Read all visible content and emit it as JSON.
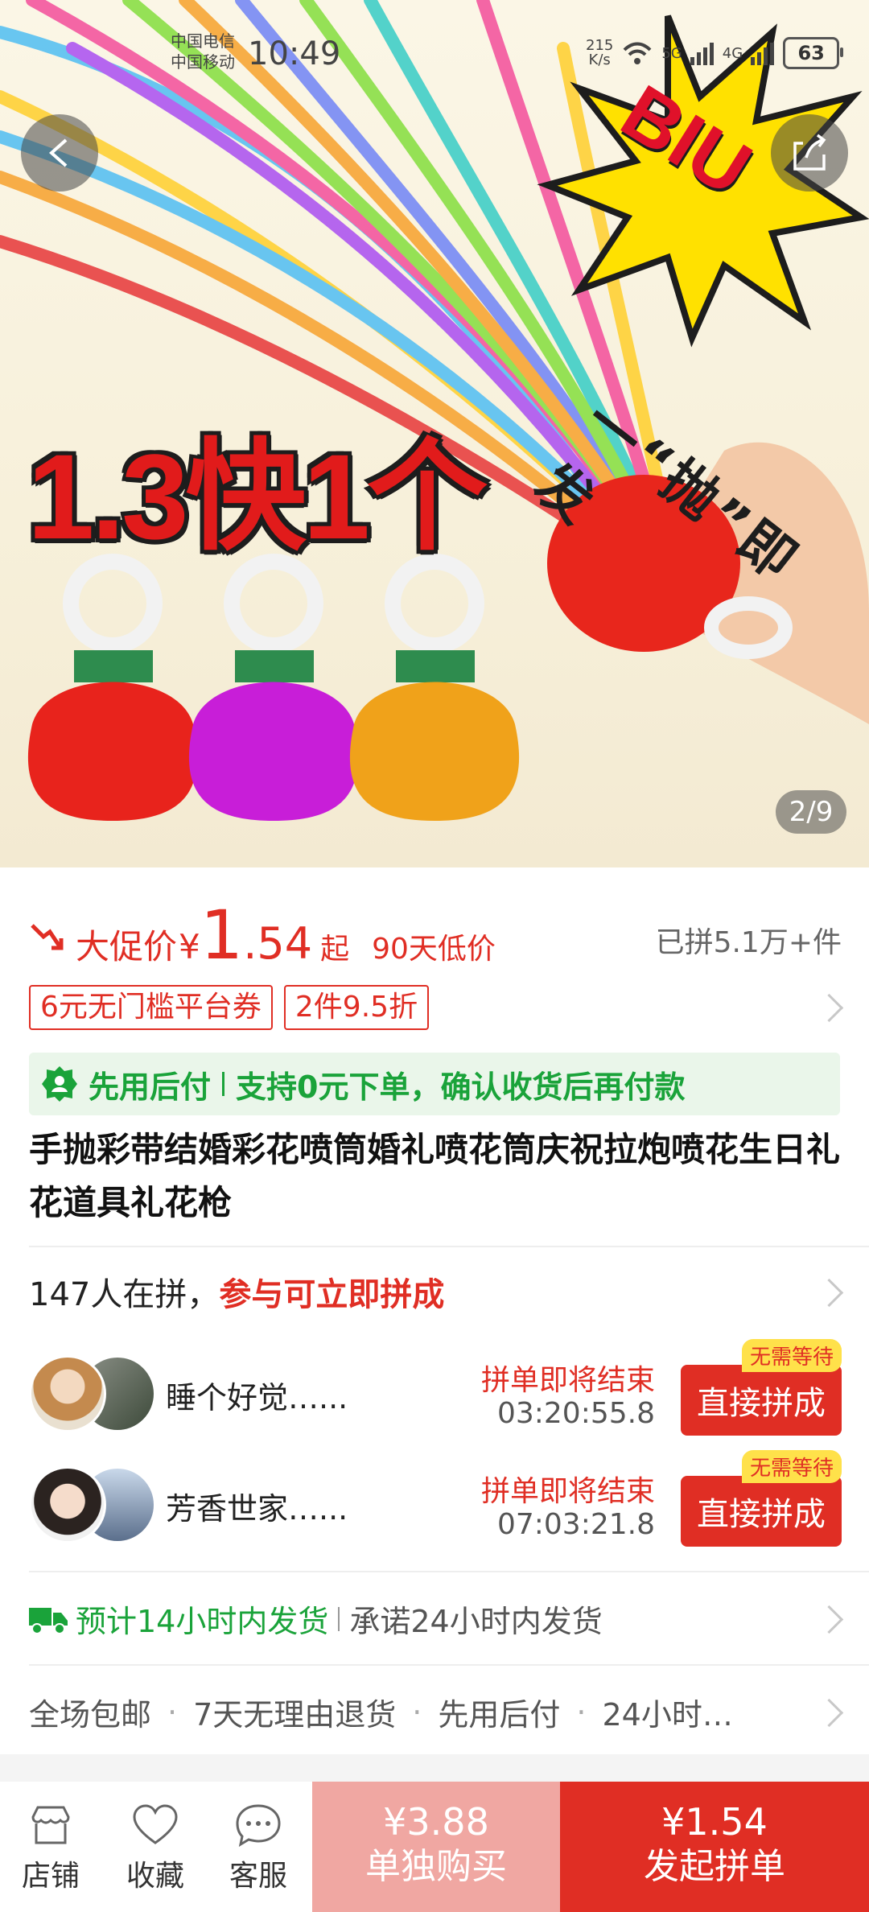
{
  "status_bar": {
    "carrier_1": "中国电信",
    "carrier_2": "中国移动",
    "time": "10:49",
    "net_speed_value": "215",
    "net_speed_unit": "K/s",
    "signal_1": "5G",
    "signal_2": "4G",
    "battery": "63"
  },
  "hero": {
    "promo_text": "1.3快1个",
    "tagline": "一“抛”即发",
    "burst_text": "BIU",
    "image_counter": "2/9"
  },
  "price": {
    "label": "大促价",
    "currency": "¥",
    "integer": "1",
    "decimal": ".54",
    "suffix": "起",
    "low_badge": "90天低价",
    "sold": "已拼5.1万+件"
  },
  "coupons": [
    "6元无门槛平台券",
    "2件9.5折"
  ],
  "pay_later": {
    "title": "先用后付",
    "desc": "支持0元下单，确认收货后再付款"
  },
  "product_title": "手抛彩带结婚彩花喷筒婚礼喷花筒庆祝拉炮喷花生日礼花道具礼花枪",
  "group_buy": {
    "count_text": "147人在拼，",
    "cta": "参与可立即拼成",
    "members": [
      {
        "name": "睡个好觉…...",
        "status": "拼单即将结束",
        "timer": "03:20:55.8",
        "button": "直接拼成",
        "tag": "无需等待"
      },
      {
        "name": "芳香世家…...",
        "status": "拼单即将结束",
        "timer": "07:03:21.8",
        "button": "直接拼成",
        "tag": "无需等待"
      }
    ]
  },
  "shipping": {
    "estimate": "预计14小时内发货",
    "promise": "承诺24小时内发货"
  },
  "guarantees": [
    "全场包邮",
    "7天无理由退货",
    "先用后付",
    "24小时…"
  ],
  "bottom_bar": {
    "store": "店铺",
    "favorite": "收藏",
    "service": "客服",
    "solo_price": "¥3.88",
    "solo_label": "单独购买",
    "group_price": "¥1.54",
    "group_label": "发起拼单"
  },
  "colors": {
    "accent_red": "#e02e24",
    "green": "#1aa33a",
    "solo_pink": "#f0a7a2",
    "badge_yellow": "#ffe14a"
  }
}
